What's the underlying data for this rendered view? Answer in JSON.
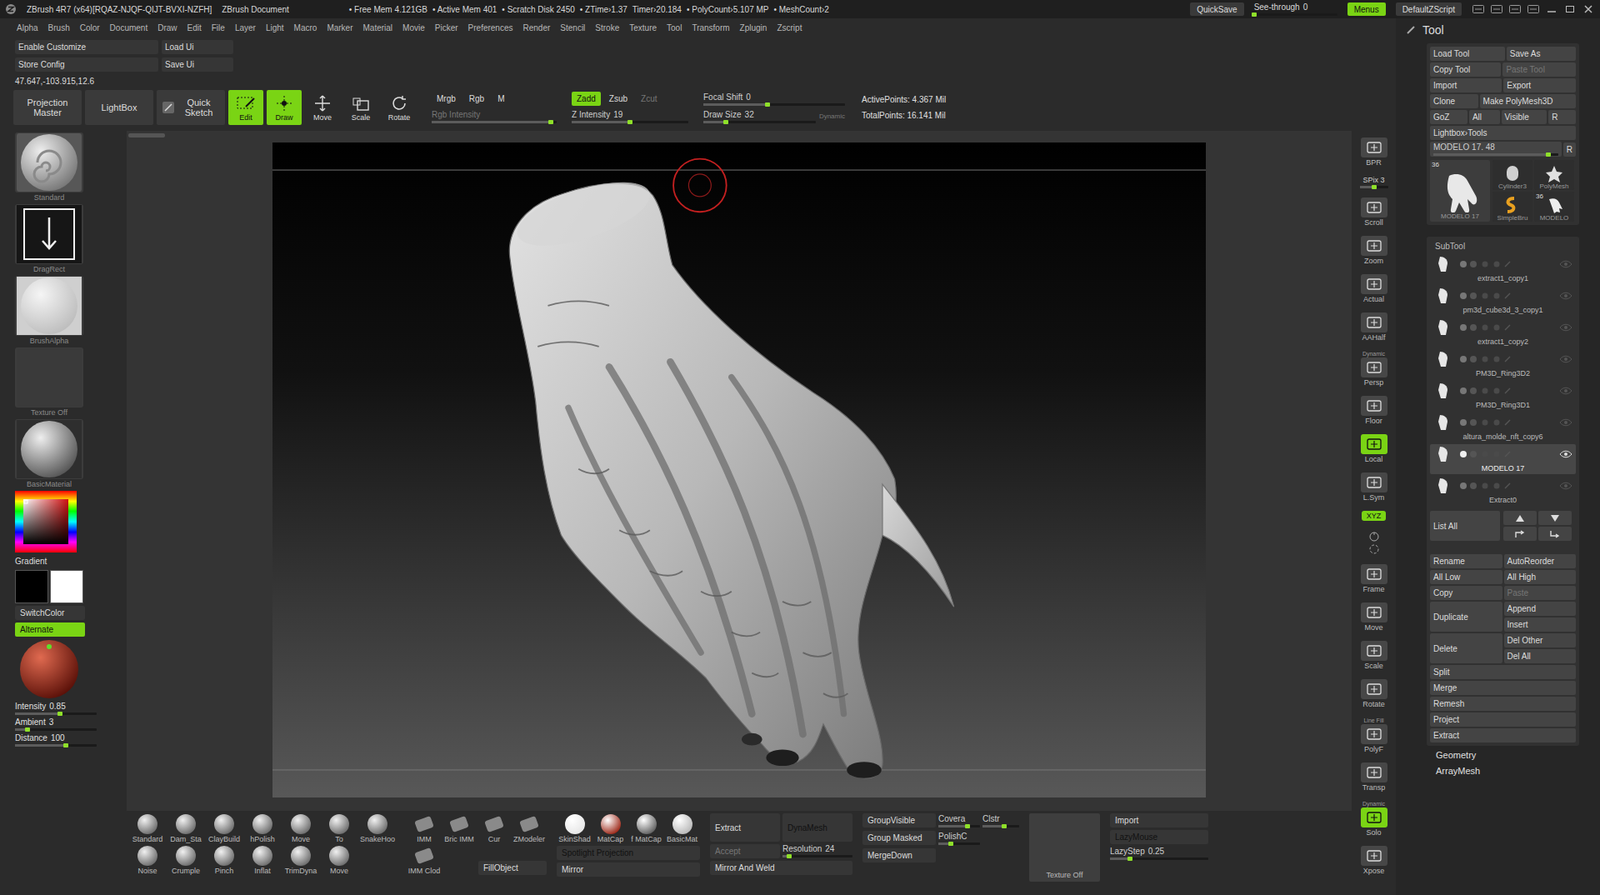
{
  "title_bar": {
    "app": "ZBrush 4R7 (x64)[RQAZ-NJQF-QIJT-BVXI-NZFH]",
    "document": "ZBrush Document",
    "stats": [
      "• Free Mem 4.121GB",
      "• Active Mem 401",
      "• Scratch Disk 2450",
      "• ZTime›1.37",
      "Timer›20.184",
      "• PolyCount›5.107 MP",
      "• MeshCount›2"
    ],
    "quicksave": "QuickSave",
    "see_through": {
      "label": "See-through",
      "value": "0",
      "level": 0
    },
    "menus": {
      "label": "Menus",
      "on": true
    },
    "script": "DefaultZScript"
  },
  "menu_bar": [
    "Alpha",
    "Brush",
    "Color",
    "Document",
    "Draw",
    "Edit",
    "File",
    "Layer",
    "Light",
    "Macro",
    "Marker",
    "Material",
    "Movie",
    "Picker",
    "Preferences",
    "Render",
    "Stencil",
    "Stroke",
    "Texture",
    "Tool",
    "Transform",
    "Zplugin",
    "Zscript"
  ],
  "config": {
    "enable_customize": "Enable Customize",
    "load_ui": "Load Ui",
    "store_config": "Store Config",
    "save_ui": "Save Ui",
    "coords": "47.647,-103.915,12.6"
  },
  "shelf": {
    "big_buttons": [
      {
        "label": "Projection Master"
      },
      {
        "label": "LightBox"
      },
      {
        "label": "Quick Sketch"
      }
    ],
    "modes": [
      {
        "label": "Edit",
        "on": true
      },
      {
        "label": "Draw",
        "on": true
      },
      {
        "label": "Move",
        "on": false
      },
      {
        "label": "Scale",
        "on": false
      },
      {
        "label": "Rotate",
        "on": false
      }
    ],
    "color_modes": [
      {
        "label": "Mrgb",
        "on": false
      },
      {
        "label": "Rgb",
        "on": false
      },
      {
        "label": "M",
        "on": false
      }
    ],
    "rgb_intensity": {
      "label": "Rgb Intensity",
      "disabled": true,
      "level": 0.95
    },
    "z_modes": [
      {
        "label": "Zadd",
        "on": true,
        "disabled": false
      },
      {
        "label": "Zsub",
        "on": false,
        "disabled": false
      },
      {
        "label": "Zcut",
        "on": false,
        "disabled": true
      }
    ],
    "z_intensity": {
      "label": "Z Intensity",
      "value": "19",
      "level": 0.5
    },
    "focal_shift": {
      "label": "Focal Shift",
      "value": "0",
      "level": 0.45
    },
    "draw_size": {
      "label": "Draw Size",
      "value": "32",
      "level": 0.2
    },
    "dynamic": "Dynamic",
    "active_points": "ActivePoints: 4.367 Mil",
    "total_points": "TotalPoints: 16.141 Mil"
  },
  "left": {
    "thumbs": [
      {
        "label": "Standard"
      },
      {
        "label": "DragRect"
      },
      {
        "label": "BrushAlpha"
      },
      {
        "label": "Texture Off"
      },
      {
        "label": "BasicMaterial"
      }
    ],
    "gradient": "Gradient",
    "swatches": [
      {
        "color": "#000000"
      },
      {
        "color": "#ffffff"
      }
    ],
    "switch_color": "SwitchColor",
    "alternate": {
      "label": "Alternate",
      "on": true
    },
    "sliders": [
      {
        "label": "Intensity",
        "value": "0.85",
        "level": 0.55
      },
      {
        "label": "Ambient",
        "value": "3",
        "level": 0.15
      },
      {
        "label": "Distance",
        "value": "100",
        "level": 0.62
      }
    ]
  },
  "right_shelf": [
    {
      "label": "BPR",
      "kind": "button",
      "on": false
    },
    {
      "label": "SPix 3",
      "kind": "slider",
      "level": 0.5
    },
    {
      "label": "Scroll",
      "kind": "button",
      "on": false
    },
    {
      "label": "Zoom",
      "kind": "button",
      "on": false
    },
    {
      "label": "Actual",
      "kind": "button",
      "on": false
    },
    {
      "label": "AAHalf",
      "kind": "button",
      "on": false
    },
    {
      "label": "Persp",
      "sub": "Dynamic",
      "kind": "button",
      "on": false
    },
    {
      "label": "Floor",
      "kind": "button",
      "on": false
    },
    {
      "label": "Local",
      "kind": "button",
      "on": true
    },
    {
      "label": "L.Sym",
      "kind": "button",
      "on": false
    },
    {
      "label": "XYZ",
      "kind": "toggle",
      "on": true
    },
    {
      "label": "Frame",
      "kind": "button",
      "on": false
    },
    {
      "label": "Move",
      "kind": "button",
      "on": false
    },
    {
      "label": "Scale",
      "kind": "button",
      "on": false
    },
    {
      "label": "Rotate",
      "kind": "button",
      "on": false
    },
    {
      "label": "PolyF",
      "sub": "Line Fill",
      "kind": "button",
      "on": false
    },
    {
      "label": "Transp",
      "kind": "button",
      "on": false
    },
    {
      "label": "Solo",
      "sub": "Dynamic",
      "kind": "button",
      "on": true
    },
    {
      "label": "Xpose",
      "kind": "button",
      "on": false
    }
  ],
  "tool": {
    "title": "Tool",
    "rows": [
      [
        {
          "label": "Load Tool",
          "disabled": false
        },
        {
          "label": "Save As",
          "disabled": false
        }
      ],
      [
        {
          "label": "Copy Tool",
          "disabled": false
        },
        {
          "label": "Paste Tool",
          "disabled": true
        }
      ],
      [
        {
          "label": "Import",
          "disabled": false
        },
        {
          "label": "Export",
          "disabled": false
        }
      ],
      [
        {
          "label": "Clone",
          "disabled": false
        },
        {
          "label": "Make PolyMesh3D",
          "disabled": false
        }
      ],
      [
        {
          "label": "GoZ",
          "disabled": false
        },
        {
          "label": "All",
          "disabled": false
        },
        {
          "label": "Visible",
          "disabled": false
        },
        {
          "label": "R",
          "disabled": false
        }
      ]
    ],
    "lightbox": "Lightbox›Tools",
    "current": {
      "label": "MODELO 17. 48",
      "level": 0.92,
      "r": "R"
    },
    "thumbs": [
      {
        "label": "MODELO 17",
        "badge": "36",
        "kind": "large"
      },
      {
        "label": "Cylinder3",
        "kind": "small"
      },
      {
        "label": "PolyMesh",
        "kind": "small"
      },
      {
        "label": "SimpleBru",
        "kind": "small"
      },
      {
        "label": "MODELO",
        "badge": "36",
        "kind": "small"
      }
    ],
    "subtool_header": "SubTool",
    "subtools": [
      {
        "name": "extract1_copy1",
        "selected": false
      },
      {
        "name": "pm3d_cube3d_3_copy1",
        "selected": false
      },
      {
        "name": "extract1_copy2",
        "selected": false
      },
      {
        "name": "PM3D_Ring3D2",
        "selected": false
      },
      {
        "name": "PM3D_Ring3D1",
        "selected": false
      },
      {
        "name": "altura_molde_nft_copy6",
        "selected": false
      },
      {
        "name": "MODELO 17",
        "selected": true
      },
      {
        "name": "Extract0",
        "selected": false
      }
    ],
    "list_all": "List All",
    "actions": [
      {
        "left": {
          "label": "Rename"
        },
        "right": [
          {
            "label": "AutoReorder",
            "disabled": false
          }
        ]
      },
      {
        "left": {
          "label": "All Low"
        },
        "right": [
          {
            "label": "All High",
            "disabled": false
          }
        ]
      },
      {
        "left": {
          "label": "Copy"
        },
        "right": [
          {
            "label": "Paste",
            "disabled": true
          }
        ]
      },
      {
        "left": {
          "label": "Duplicate"
        },
        "right": [
          {
            "label": "Append",
            "disabled": false
          },
          {
            "label": "Insert",
            "disabled": false
          }
        ]
      },
      {
        "left": {
          "label": "Delete"
        },
        "right": [
          {
            "label": "Del Other",
            "disabled": false
          },
          {
            "label": "Del All",
            "disabled": false
          }
        ]
      }
    ],
    "singles": [
      "Split",
      "Merge",
      "Remesh",
      "Project",
      "Extract"
    ],
    "sections": [
      "Geometry",
      "ArrayMesh"
    ]
  },
  "bottom": {
    "brushes": [
      "Standard",
      "Dam_Sta",
      "ClayBuild",
      "hPolish",
      "Move",
      "To",
      "SnakeHoo",
      "Noise",
      "Crumple",
      "Pinch",
      "Inflat",
      "TrimDyna",
      "Move"
    ],
    "imm": [
      "IMM",
      "Bric IMM",
      "Cur",
      "ZModeler",
      "IMM Clod"
    ],
    "fill_object": "FillObject",
    "materials": [
      {
        "label": "SkinShad",
        "color": "#e6e6e6"
      },
      {
        "label": "MatCap",
        "color": "#9c2616"
      },
      {
        "label": "f MatCap",
        "color": "#5e5e5e"
      },
      {
        "label": "BasicMat",
        "color": "#b8b8b8"
      }
    ],
    "spotlight": {
      "label": "Spotlight Projection",
      "on": true
    },
    "mirror": "Mirror",
    "extract": "Extract",
    "accept": {
      "label": "Accept",
      "disabled": true
    },
    "dynamesh": {
      "label": "DynaMesh",
      "on": true
    },
    "resolution": {
      "label": "Resolution",
      "value": "24",
      "level": 0.1
    },
    "mirror_weld": "Mirror And Weld",
    "group_visible": "GroupVisible",
    "covera": {
      "label": "Covera",
      "level": 0.7
    },
    "clstr": {
      "label": "Clstr",
      "level": 0.6
    },
    "group_masked": "Group Masked",
    "polish": {
      "label": "PolishC",
      "level": 0.3
    },
    "merge_down": "MergeDown",
    "texture_off": "Texture Off",
    "import": "Import",
    "lazymouse": {
      "label": "LazyMouse",
      "on": true
    },
    "lazystep": {
      "label": "LazyStep",
      "value": "0.25",
      "level": 0.2
    }
  }
}
